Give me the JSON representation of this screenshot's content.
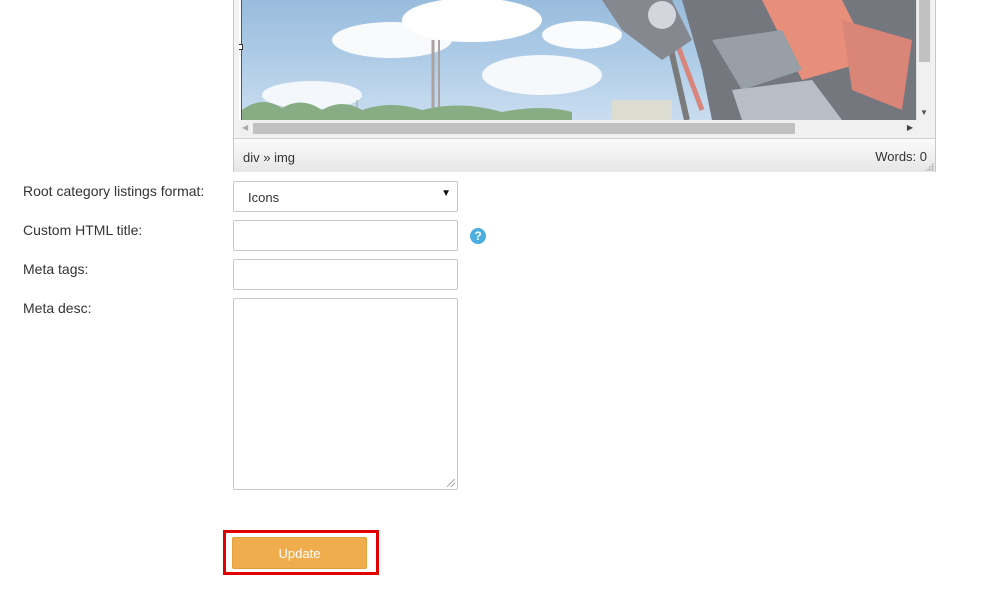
{
  "editor": {
    "status_path": "div » img",
    "word_count": "Words: 0"
  },
  "form": {
    "root_format_label": "Root category listings format:",
    "root_format_value": "Icons",
    "html_title_label": "Custom HTML title:",
    "html_title_value": "",
    "meta_tags_label": "Meta tags:",
    "meta_tags_value": "",
    "meta_desc_label": "Meta desc:",
    "meta_desc_value": "",
    "help_glyph": "?",
    "update_label": "Update"
  },
  "colors": {
    "update_button": "#f0ad4e",
    "highlight_border": "#e00000",
    "help_icon": "#4aaee0"
  }
}
